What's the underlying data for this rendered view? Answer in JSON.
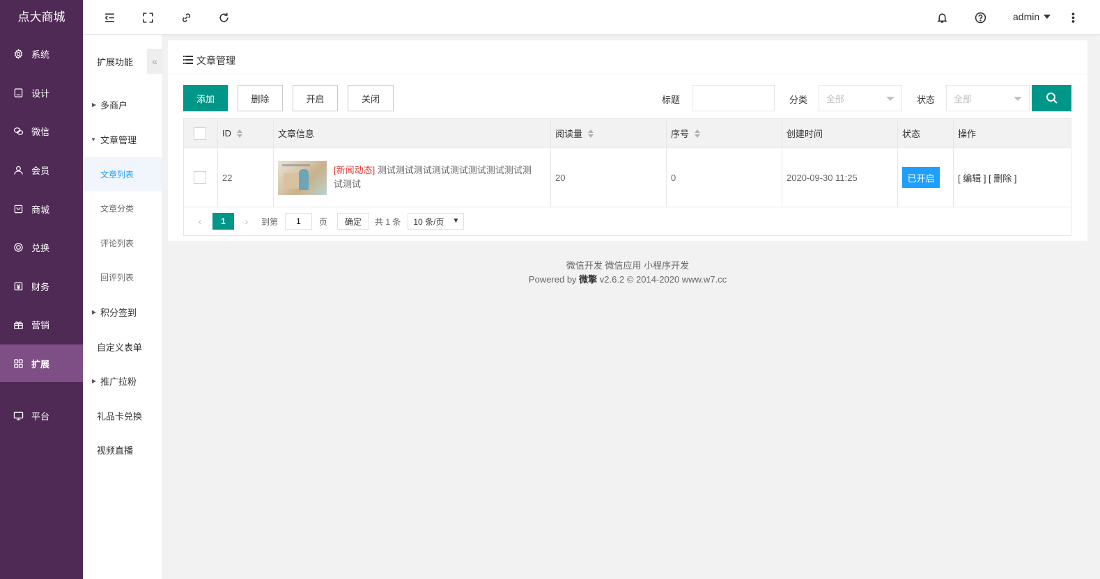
{
  "brand": "点大商城",
  "main_menu": [
    {
      "label": "系统",
      "icon": "gear-icon"
    },
    {
      "label": "设计",
      "icon": "design-icon"
    },
    {
      "label": "微信",
      "icon": "wechat-icon"
    },
    {
      "label": "会员",
      "icon": "user-icon"
    },
    {
      "label": "商城",
      "icon": "shop-icon"
    },
    {
      "label": "兑换",
      "icon": "exchange-icon"
    },
    {
      "label": "财务",
      "icon": "finance-icon"
    },
    {
      "label": "营销",
      "icon": "gift-icon"
    },
    {
      "label": "扩展",
      "icon": "grid-icon",
      "active": true
    },
    {
      "label": "平台",
      "icon": "monitor-icon"
    }
  ],
  "sub_menu": {
    "header": "扩展功能",
    "items": [
      {
        "label": "多商户",
        "type": "group",
        "expanded": false
      },
      {
        "label": "文章管理",
        "type": "group",
        "expanded": true
      },
      {
        "label": "文章列表",
        "type": "child",
        "active": true
      },
      {
        "label": "文章分类",
        "type": "child"
      },
      {
        "label": "评论列表",
        "type": "child"
      },
      {
        "label": "回评列表",
        "type": "child"
      },
      {
        "label": "积分签到",
        "type": "group",
        "expanded": false
      },
      {
        "label": "自定义表单",
        "type": "plain"
      },
      {
        "label": "推广拉粉",
        "type": "group",
        "expanded": false
      },
      {
        "label": "礼品卡兑换",
        "type": "plain"
      },
      {
        "label": "视频直播",
        "type": "plain"
      }
    ]
  },
  "topbar": {
    "icons": [
      "menu-fold-icon",
      "fullscreen-icon",
      "link-icon",
      "refresh-icon"
    ],
    "right_icons": [
      "bell-icon",
      "help-icon"
    ],
    "user": "admin"
  },
  "card": {
    "title": "文章管理",
    "buttons": {
      "add": "添加",
      "delete": "删除",
      "enable": "开启",
      "disable": "关闭"
    },
    "filters": {
      "title_label": "标题",
      "title_value": "",
      "category_label": "分类",
      "category_value": "全部",
      "status_label": "状态",
      "status_value": "全部"
    }
  },
  "table": {
    "columns": [
      "ID",
      "文章信息",
      "阅读量",
      "序号",
      "创建时间",
      "状态",
      "操作"
    ],
    "rows": [
      {
        "id": "22",
        "tag": "[新闻动态]",
        "title": "测试测试测试测试测试测试测试测试测试测试",
        "reads": "20",
        "order": "0",
        "created": "2020-09-30 11:25",
        "status": "已开启",
        "op_edit": "[ 编辑 ]",
        "op_delete": "[ 删除 ]"
      }
    ]
  },
  "pager": {
    "current": "1",
    "goto_label": "到第",
    "goto_value": "1",
    "page_label": "页",
    "ok": "确定",
    "total": "共 1 条",
    "per_page": "10 条/页"
  },
  "footer": {
    "links": "微信开发 微信应用 小程序开发",
    "powered_prefix": "Powered by ",
    "powered_brand": "微擎",
    "powered_suffix": " v2.6.2 © 2014-2020 www.w7.cc"
  },
  "colors": {
    "sidebar": "#4f2a55",
    "sidebar_active": "#7d4f84",
    "primary": "#009688",
    "status_on": "#1e9fff",
    "tag_red": "#e53935"
  }
}
